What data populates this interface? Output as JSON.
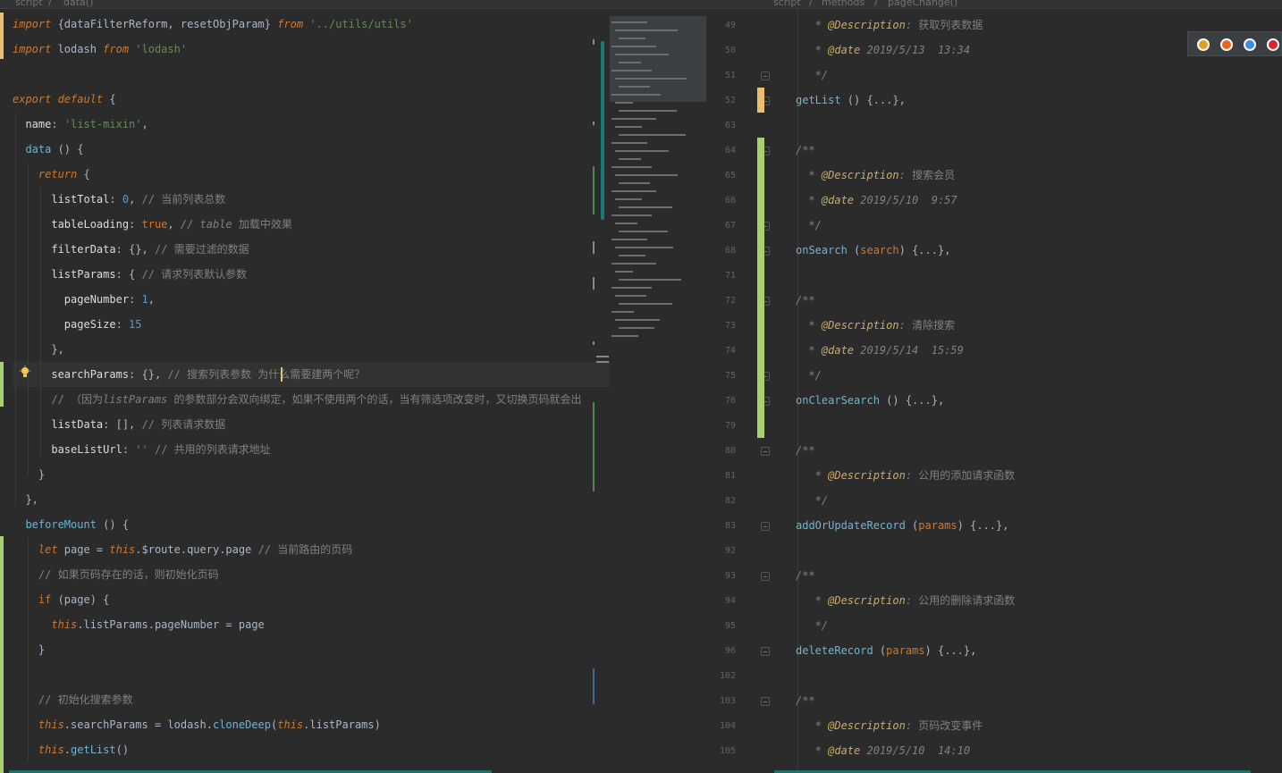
{
  "breadcrumb_left": [
    "script",
    "data()"
  ],
  "breadcrumb_right": [
    "script",
    "methods",
    "pageChange()"
  ],
  "left_code": [
    {
      "segs": [
        [
          "kw",
          "import"
        ],
        [
          "brace",
          " {dataFilterReform, resetObjParam} "
        ],
        [
          "kw",
          "from"
        ],
        [
          "str",
          " '../utils/utils'"
        ]
      ]
    },
    {
      "segs": [
        [
          "kw",
          "import"
        ],
        [
          "brace",
          " lodash "
        ],
        [
          "kw",
          "from"
        ],
        [
          "str",
          " 'lodash'"
        ]
      ]
    },
    {
      "segs": []
    },
    {
      "segs": [
        [
          "kw",
          "export default"
        ],
        [
          "brace",
          " {"
        ]
      ]
    },
    {
      "segs": [
        [
          "prop",
          "  name"
        ],
        [
          "brace",
          ": "
        ],
        [
          "str",
          "'list-mixin'"
        ],
        [
          "brace",
          ","
        ]
      ]
    },
    {
      "segs": [
        [
          "meth",
          "  data"
        ],
        [
          "brace",
          " () {"
        ]
      ]
    },
    {
      "segs": [
        [
          "kw",
          "    return"
        ],
        [
          "brace",
          " {"
        ]
      ]
    },
    {
      "segs": [
        [
          "prop",
          "      listTotal"
        ],
        [
          "brace",
          ": "
        ],
        [
          "num",
          "0"
        ],
        [
          "brace",
          ", "
        ],
        [
          "cm",
          "// 当前列表总数"
        ]
      ]
    },
    {
      "segs": [
        [
          "prop",
          "      tableLoading"
        ],
        [
          "brace",
          ": "
        ],
        [
          "kw2",
          "true"
        ],
        [
          "brace",
          ", "
        ],
        [
          "cmi",
          "// table "
        ],
        [
          "cm",
          "加载中效果"
        ]
      ]
    },
    {
      "segs": [
        [
          "prop",
          "      filterData"
        ],
        [
          "brace",
          ": {}, "
        ],
        [
          "cm",
          "// 需要过滤的数据"
        ]
      ]
    },
    {
      "segs": [
        [
          "prop",
          "      listParams"
        ],
        [
          "brace",
          ": { "
        ],
        [
          "cm",
          "// 请求列表默认参数"
        ]
      ]
    },
    {
      "segs": [
        [
          "prop",
          "        pageNumber"
        ],
        [
          "brace",
          ": "
        ],
        [
          "num",
          "1"
        ],
        [
          "brace",
          ","
        ]
      ]
    },
    {
      "segs": [
        [
          "prop",
          "        pageSize"
        ],
        [
          "brace",
          ": "
        ],
        [
          "num",
          "15"
        ]
      ]
    },
    {
      "segs": [
        [
          "brace",
          "      },"
        ]
      ]
    },
    {
      "segs": [
        [
          "prop",
          "      searchParams"
        ],
        [
          "brace",
          ": {}, "
        ],
        [
          "cm",
          "// 搜索列表参数 为什么需要建两个呢？"
        ]
      ]
    },
    {
      "segs": [
        [
          "cm",
          "      // （因为"
        ],
        [
          "cmi",
          "listParams"
        ],
        [
          "cm",
          " 的参数部分会双向绑定，如果不使用两个的话，当有筛选项改变时，又切换页码就会出"
        ]
      ]
    },
    {
      "segs": [
        [
          "prop",
          "      listData"
        ],
        [
          "brace",
          ": [], "
        ],
        [
          "cm",
          "// 列表请求数据"
        ]
      ]
    },
    {
      "segs": [
        [
          "prop",
          "      baseListUrl"
        ],
        [
          "brace",
          ": "
        ],
        [
          "str",
          "''"
        ],
        [
          "brace",
          " "
        ],
        [
          "cm",
          "// 共用的列表请求地址"
        ]
      ]
    },
    {
      "segs": [
        [
          "brace",
          "    }"
        ]
      ]
    },
    {
      "segs": [
        [
          "brace",
          "  },"
        ]
      ]
    },
    {
      "segs": [
        [
          "meth",
          "  beforeMount"
        ],
        [
          "brace",
          " () {"
        ]
      ]
    },
    {
      "segs": [
        [
          "kw",
          "    let"
        ],
        [
          "brace",
          " page = "
        ],
        [
          "this",
          "this"
        ],
        [
          "brace",
          ".$route.query.page "
        ],
        [
          "cm",
          "// 当前路由的页码"
        ]
      ]
    },
    {
      "segs": [
        [
          "cm",
          "    // 如果页码存在的话，则初始化页码"
        ]
      ]
    },
    {
      "segs": [
        [
          "kw2",
          "    if"
        ],
        [
          "brace",
          " (page) {"
        ]
      ]
    },
    {
      "segs": [
        [
          "this",
          "      this"
        ],
        [
          "brace",
          ".listParams.pageNumber = page"
        ]
      ]
    },
    {
      "segs": [
        [
          "brace",
          "    }"
        ]
      ]
    },
    {
      "segs": []
    },
    {
      "segs": [
        [
          "cm",
          "    // 初始化搜索参数"
        ]
      ]
    },
    {
      "segs": [
        [
          "this",
          "    this"
        ],
        [
          "brace",
          ".searchParams = lodash."
        ],
        [
          "meth",
          "cloneDeep"
        ],
        [
          "brace",
          "("
        ],
        [
          "this",
          "this"
        ],
        [
          "brace",
          ".listParams)"
        ]
      ]
    },
    {
      "segs": [
        [
          "this",
          "    this"
        ],
        [
          "brace",
          "."
        ],
        [
          "meth",
          "getList"
        ],
        [
          "brace",
          "()"
        ]
      ]
    }
  ],
  "right_line_numbers": [
    "49",
    "50",
    "51",
    "52",
    "63",
    "64",
    "65",
    "66",
    "67",
    "68",
    "71",
    "72",
    "73",
    "74",
    "75",
    "76",
    "79",
    "80",
    "81",
    "82",
    "83",
    "92",
    "93",
    "94",
    "95",
    "96",
    "102",
    "103",
    "104",
    "105"
  ],
  "right_code": [
    {
      "segs": [
        [
          "cmi",
          "   * "
        ],
        [
          "tag",
          "@Description"
        ],
        [
          "cmi",
          ": "
        ],
        [
          "cm",
          "获取列表数据"
        ]
      ]
    },
    {
      "segs": [
        [
          "cmi",
          "   * "
        ],
        [
          "tag",
          "@date"
        ],
        [
          "cmi",
          " 2019/5/13  13:34"
        ]
      ]
    },
    {
      "segs": [
        [
          "cmi",
          "   */"
        ]
      ]
    },
    {
      "segs": [
        [
          "meth",
          "getList"
        ],
        [
          "brace",
          " () "
        ],
        [
          "ph",
          "{...}"
        ],
        [
          "brace",
          ","
        ]
      ]
    },
    {
      "segs": []
    },
    {
      "segs": [
        [
          "cmi",
          "/**"
        ]
      ]
    },
    {
      "segs": [
        [
          "cmi",
          "  * "
        ],
        [
          "tag",
          "@Description"
        ],
        [
          "cmi",
          ": "
        ],
        [
          "cm",
          "搜索会员"
        ]
      ]
    },
    {
      "segs": [
        [
          "cmi",
          "  * "
        ],
        [
          "tag",
          "@date"
        ],
        [
          "cmi",
          " 2019/5/10  9:57"
        ]
      ]
    },
    {
      "segs": [
        [
          "cmi",
          "  */"
        ]
      ]
    },
    {
      "segs": [
        [
          "meth",
          "onSearch"
        ],
        [
          "brace",
          " ("
        ],
        [
          "kw2",
          "search"
        ],
        [
          "brace",
          ") "
        ],
        [
          "ph",
          "{...}"
        ],
        [
          "brace",
          ","
        ]
      ]
    },
    {
      "segs": []
    },
    {
      "segs": [
        [
          "cmi",
          "/**"
        ]
      ]
    },
    {
      "segs": [
        [
          "cmi",
          "  * "
        ],
        [
          "tag",
          "@Description"
        ],
        [
          "cmi",
          ": "
        ],
        [
          "cm",
          "清除搜索"
        ]
      ]
    },
    {
      "segs": [
        [
          "cmi",
          "  * "
        ],
        [
          "tag",
          "@date"
        ],
        [
          "cmi",
          " 2019/5/14  15:59"
        ]
      ]
    },
    {
      "segs": [
        [
          "cmi",
          "  */"
        ]
      ]
    },
    {
      "segs": [
        [
          "meth",
          "onClearSearch"
        ],
        [
          "brace",
          " () "
        ],
        [
          "ph",
          "{...}"
        ],
        [
          "brace",
          ","
        ]
      ]
    },
    {
      "segs": []
    },
    {
      "segs": [
        [
          "cmi",
          "/**"
        ]
      ]
    },
    {
      "segs": [
        [
          "cmi",
          "   * "
        ],
        [
          "tag",
          "@Description"
        ],
        [
          "cmi",
          ": "
        ],
        [
          "cm",
          "公用的添加请求函数"
        ]
      ]
    },
    {
      "segs": [
        [
          "cmi",
          "   */"
        ]
      ]
    },
    {
      "segs": [
        [
          "meth",
          "addOrUpdateRecord"
        ],
        [
          "brace",
          " ("
        ],
        [
          "kw2",
          "params"
        ],
        [
          "brace",
          ") "
        ],
        [
          "ph",
          "{...}"
        ],
        [
          "brace",
          ","
        ]
      ]
    },
    {
      "segs": []
    },
    {
      "segs": [
        [
          "cmi",
          "/**"
        ]
      ]
    },
    {
      "segs": [
        [
          "cmi",
          "   * "
        ],
        [
          "tag",
          "@Description"
        ],
        [
          "cmi",
          ": "
        ],
        [
          "cm",
          "公用的删除请求函数"
        ]
      ]
    },
    {
      "segs": [
        [
          "cmi",
          "   */"
        ]
      ]
    },
    {
      "segs": [
        [
          "meth",
          "deleteRecord"
        ],
        [
          "brace",
          " ("
        ],
        [
          "kw2",
          "params"
        ],
        [
          "brace",
          ") "
        ],
        [
          "ph",
          "{...}"
        ],
        [
          "brace",
          ","
        ]
      ]
    },
    {
      "segs": []
    },
    {
      "segs": [
        [
          "cmi",
          "/**"
        ]
      ]
    },
    {
      "segs": [
        [
          "cmi",
          "   * "
        ],
        [
          "tag",
          "@Description"
        ],
        [
          "cmi",
          ": "
        ],
        [
          "cm",
          "页码改变事件"
        ]
      ]
    },
    {
      "segs": [
        [
          "cmi",
          "   * "
        ],
        [
          "tag",
          "@date"
        ],
        [
          "cmi",
          " 2019/5/10  14:10"
        ]
      ]
    }
  ],
  "browser_icons": [
    {
      "name": "chrome-icon",
      "color": "#e0a020"
    },
    {
      "name": "firefox-icon",
      "color": "#e8661a"
    },
    {
      "name": "safari-icon",
      "color": "#3a8ee6"
    },
    {
      "name": "opera-icon",
      "color": "#d9262c"
    }
  ],
  "colors": {
    "green_mark": "#a6d16e",
    "yellow_mark": "#e8bf6a",
    "thumb": "#187c74"
  }
}
